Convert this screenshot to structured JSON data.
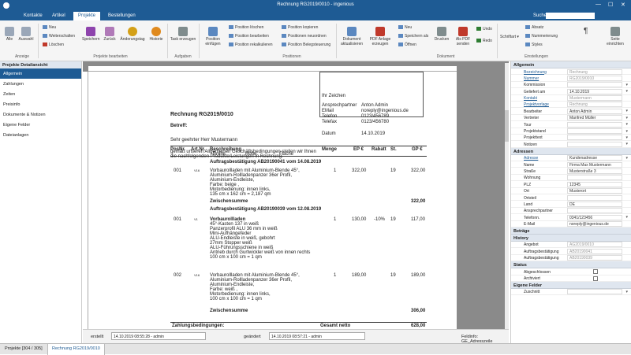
{
  "window": {
    "title": "Rechnung RG2019/0010 - ingenious",
    "minimize": "—",
    "maximize": "☐",
    "close": "✕"
  },
  "menu": {
    "items": [
      "Kontakte",
      "Artikel",
      "Projekte",
      "Bestellungen"
    ],
    "active": "Projekte",
    "search_label": "Suche:"
  },
  "ribbon": {
    "alle": "Alle",
    "auswahl": "Auswahl",
    "neu": "Neu",
    "weiterschalten": "Weiterschalten",
    "loeschen": "Löschen",
    "speichern": "Speichern",
    "zurueck": "Zurück",
    "aenderungstag": "Änderungstag",
    "historie": "Historie",
    "task": "Task erzeugen",
    "position_einfuegen": "Position einfügen",
    "pos_col1": [
      "Position löschen",
      "Position bearbeiten",
      "Position rekalkulieren"
    ],
    "pos_col2": [
      "Position kopieren",
      "Positionen neuordnen",
      "Position Belegsteuerung"
    ],
    "dokument_aktualisieren": "Dokument aktualisieren",
    "pdf_anlage": "PDF Anlage erzeugen",
    "neu2": "Neu",
    "speichern_als": "Speichern als",
    "oeffnen": "Öffnen",
    "drucken": "Drucken",
    "als_pdf": "Als PDF senden",
    "undo": "Undo",
    "redo": "Redo",
    "schriftart": "Schriftart",
    "absatz": "Absatz",
    "nummerierung": "Nummerierung",
    "styles": "Styles",
    "seite_einrichten": "Seite einrichten",
    "pilcrow": "¶",
    "groups": [
      "Anzeige",
      "Projekte bearbeiten",
      "Aufgaben",
      "Positionen",
      "Dokument",
      "Einstellungen"
    ]
  },
  "left_panel": {
    "header": "Projekte Detailansicht",
    "items": [
      "Allgemein",
      "Zahlungen",
      "Zeiten",
      "Preisinfo",
      "Dokumente & Notizen",
      "Eigene Felder",
      "Dateianlagen"
    ]
  },
  "document": {
    "ihr_zeichen": "Ihr Zeichen",
    "contact": [
      [
        "Ansprechpartner",
        "Anton Admin"
      ],
      [
        "EMail",
        "noreply@ingenious.de"
      ],
      [
        "Telefon",
        "0123/456789"
      ],
      [
        "Telefax",
        "0123/456780"
      ]
    ],
    "datum_label": "Datum",
    "datum": "14.10.2019",
    "title": "Rechnung RG2019/0010",
    "betreff": "Betreff:",
    "anrede": "Sehr geehrter Herr Mustermann",
    "intro1": "gemäß unseren Allgemeinen Geschäftsbedingungen stellen wir Ihnen",
    "intro2": "die nachfolgenden Produkte/Leistungen in Rechnung:",
    "cols": [
      "PosNr.",
      "Art.Nr.",
      "Beschreibung",
      "Menge",
      "EP €",
      "Rabatt",
      "St.",
      "GP €"
    ],
    "subcols": [
      "Breite",
      "Höhe",
      "Fläche"
    ],
    "ab1": "Auftragsbestätigung AB20190041 vom 14.08.2019",
    "pos1": {
      "nr": "001",
      "art": "V16",
      "menge": "1",
      "ep": "322,00",
      "st": "19",
      "gp": "322,00",
      "lines": [
        "Vorbaurollladen mit Aluminium-Blende 45°,",
        "Aluminium-Rollladenpanzer 36er Profil,",
        "Aluminium-Endleiste,",
        "Farbe: beige ,",
        "Motorbedienung: innen links,",
        "135 cm      x    162 cm      =     2,187 qm"
      ]
    },
    "zwischensumme": "Zwischensumme",
    "zs1": "322,00",
    "ab2": "Auftragsbestätigung AB20190039 vom 12.08.2019",
    "pos2": {
      "nr": "001",
      "art": "V1",
      "menge": "1",
      "ep": "130,00",
      "rabatt": "-10%",
      "st": "19",
      "gp": "117,00",
      "lines": [
        "45°-Kasten 137 in weiß",
        "Panzerprofil ALU 36 mm in weiß",
        "Mini-Aufhängefeder",
        "ALU-Endleiste in weiß, gebohrt",
        "27mm Stopper weiß",
        "ALU-Führungsschiene in weiß",
        "Antrieb durch Gurtwickler weiß von innen rechts",
        "100 cm      x    100 cm      =     1 qm"
      ],
      "title": "Vorbaurollladen"
    },
    "pos3": {
      "nr": "002",
      "art": "V16",
      "menge": "1",
      "ep": "189,00",
      "st": "19",
      "gp": "189,00",
      "lines": [
        "Vorbaurollladen mit Aluminium-Blende 45°,",
        "Aluminium-Rollladenpanzer 36er Profil,",
        "Aluminium-Endleiste,",
        "Farbe: weiß ,",
        "Motorbedienung: innen links,",
        "100 cm      x    100 cm      =     1 qm"
      ]
    },
    "zs2": "306,00",
    "zahlungsbed": "Zahlungsbedingungen:",
    "gesamt_netto": "Gesamt netto",
    "gesamt_value": "628,00"
  },
  "right_panel": {
    "allgemein": "Allgemein",
    "rows": [
      {
        "l": "Bezeichnung",
        "v": "Rechnung",
        "link": true,
        "gray": true
      },
      {
        "l": "Nummer",
        "v": "RG2019/0010",
        "link": true,
        "gray": true
      },
      {
        "l": "Kommission",
        "v": "",
        "dd": true
      },
      {
        "l": "Geliefert am",
        "v": "14.10.2019",
        "dd": true
      },
      {
        "l": "Kontakt",
        "v": "Mustermann",
        "link": true,
        "gray": true
      },
      {
        "l": "Projektvorlage",
        "v": "Rechnung",
        "link": true,
        "gray": true
      },
      {
        "l": "Bearbeiter",
        "v": "Anton Admin",
        "dd": true
      },
      {
        "l": "Vertreter",
        "v": "Manfred Müller",
        "dd": true
      },
      {
        "l": "Tour",
        "v": "",
        "dd": true
      },
      {
        "l": "Projektstand",
        "v": "",
        "dd": true
      },
      {
        "l": "Projekttext",
        "v": "",
        "dd": true
      },
      {
        "l": "Notizen",
        "v": "",
        "dd": true
      }
    ],
    "adressen": "Adressen",
    "addr_rows": [
      {
        "l": "Adresse",
        "v": "Kundenadresse",
        "link": true,
        "dd": true
      },
      {
        "l": "Name",
        "v": "Firma Max Mustermann"
      },
      {
        "l": "Straße",
        "v": "Musterstraße 3"
      },
      {
        "l": "Wohnung",
        "v": ""
      },
      {
        "l": "PLZ",
        "v": "12345"
      },
      {
        "l": "Ort",
        "v": "Musterort"
      },
      {
        "l": "Ortsteil",
        "v": ""
      },
      {
        "l": "Land",
        "v": "DE"
      },
      {
        "l": "Ansprechpartner",
        "v": ""
      },
      {
        "l": "Telefonn.",
        "v": "0341/123456",
        "dd": true
      },
      {
        "l": "E-Mail",
        "v": "noreply@ingenious.de"
      }
    ],
    "betraege": "Beträge",
    "history": "History",
    "hist_rows": [
      {
        "l": "Angebot",
        "v": "AG2019/0010",
        "gray": true
      },
      {
        "l": "Auftragsbestätigung",
        "v": "AB20190041",
        "gray": true
      },
      {
        "l": "Auftragsbestätigung",
        "v": "AB20190039",
        "gray": true
      }
    ],
    "status": "Status",
    "status_rows": [
      {
        "l": "Abgeschlossen"
      },
      {
        "l": "Archiviert"
      }
    ],
    "eigene": "Eigene Felder",
    "eig_rows": [
      {
        "l": "Zuschnitt",
        "v": "",
        "dd": true
      }
    ]
  },
  "status": {
    "erstellt": "erstellt",
    "erstellt_v": "14.10.2019 08:55:28 - admin",
    "geaendert": "geändert",
    "geaendert_v": "14.10.2019 08:57:21 - admin",
    "feldinfo": "Feldinfo: GE_Adresszeile"
  },
  "bottom_tabs": [
    "Projekte [304 / 305]",
    "Rechnung RG2019/0010"
  ],
  "colors": {
    "accent": "#1e5b94"
  }
}
